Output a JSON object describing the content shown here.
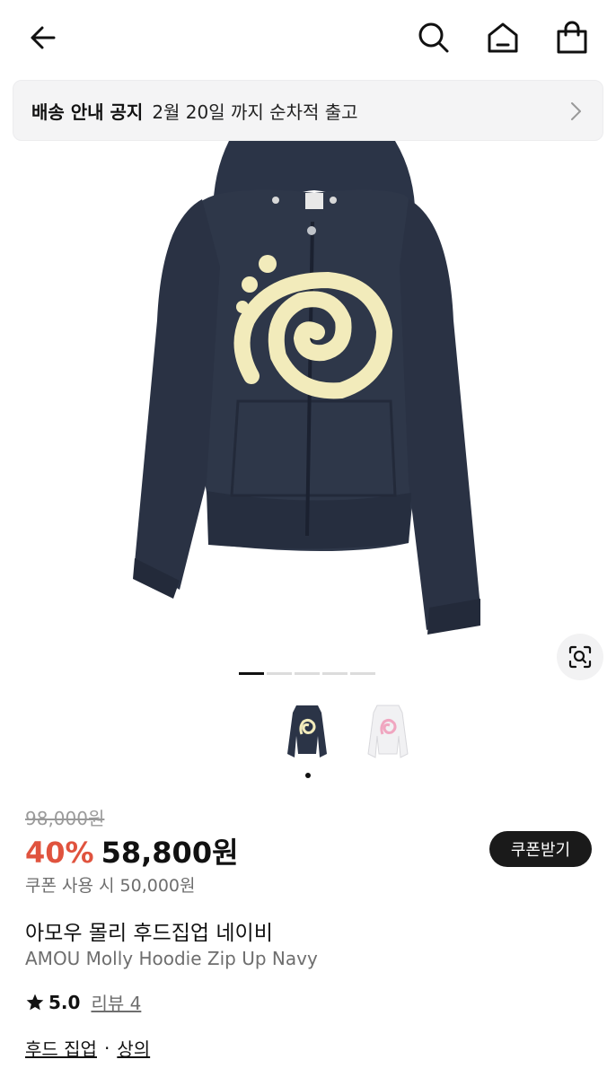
{
  "header": {
    "back_icon": "arrow-left-icon",
    "search_icon": "search-icon",
    "home_icon": "home-icon",
    "bag_icon": "shopping-bag-icon"
  },
  "notice": {
    "label": "배송 안내 공지",
    "text": "2월 20일 까지 순차적 출고",
    "chevron_icon": "chevron-right-icon"
  },
  "gallery": {
    "pages": 5,
    "active_page": 1,
    "thumbnails": [
      "navy",
      "white"
    ],
    "active_thumbnail": 0,
    "lens_icon": "lens-search-icon"
  },
  "pricing": {
    "original": "98,000원",
    "discount": "40%",
    "price": "58,800원",
    "coupon_button": "쿠폰받기",
    "coupon_note": "쿠폰 사용 시 50,000원"
  },
  "product": {
    "name_ko": "아모우 몰리 후드집업 네이비",
    "name_en": "AMOU Molly Hoodie Zip Up Navy"
  },
  "rating": {
    "score": "5.0",
    "reviews": "리뷰 4"
  },
  "category": {
    "primary": "후드 집업",
    "separator": "·",
    "secondary": "상의"
  },
  "colors": {
    "accent_discount": "#e0533e",
    "hoodie_navy": "#2b3447",
    "print_cream": "#f2ebbb"
  }
}
